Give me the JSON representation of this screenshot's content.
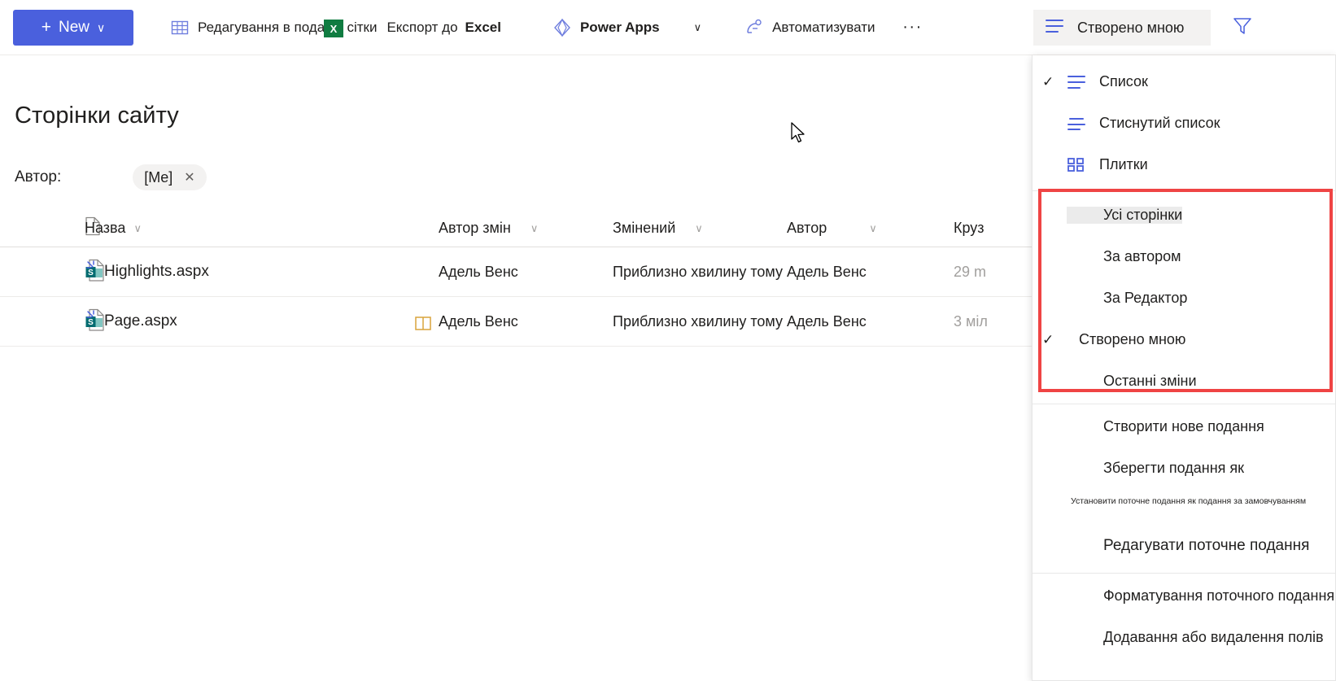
{
  "commandbar": {
    "new_button": {
      "label": "New",
      "plus": "+",
      "chevron": "∨"
    },
    "items": [
      {
        "name": "grid-edit",
        "label": "Редагування в поданні сітки",
        "icon": "grid-icon"
      },
      {
        "name": "export-excel",
        "label": "Експорт до",
        "label2": "Excel",
        "icon": "excel-icon"
      },
      {
        "name": "power-apps",
        "label": "Power Apps",
        "icon": "powerapps-icon",
        "chevron": "∨"
      },
      {
        "name": "automate",
        "label": "Автоматизувати",
        "icon": "automate-icon"
      }
    ],
    "overflow": "···"
  },
  "view": {
    "current_label": "Створено мною",
    "filter_icon": "filter-icon",
    "menu": [
      {
        "label": "Список",
        "icon": "list-icon",
        "checked": true,
        "group": "layout"
      },
      {
        "label": "Стиснутий список",
        "icon": "compact-list-icon",
        "checked": false,
        "group": "layout"
      },
      {
        "label": "Плитки",
        "icon": "tiles-icon",
        "checked": false,
        "group": "layout"
      },
      {
        "label": "Усі сторінки",
        "checked": false,
        "group": "views",
        "highlighted": true
      },
      {
        "label": "За автором",
        "checked": false,
        "group": "views"
      },
      {
        "label": "За Редактор",
        "checked": false,
        "group": "views"
      },
      {
        "label": "Створено мною",
        "checked": true,
        "group": "views"
      },
      {
        "label": "Останні зміни",
        "checked": false,
        "group": "views"
      },
      {
        "label": "Створити нове подання",
        "checked": false,
        "group": "actions"
      },
      {
        "label": "Зберегти подання як",
        "checked": false,
        "group": "actions"
      },
      {
        "label": "Редагувати поточне подання",
        "checked": false,
        "group": "actions"
      },
      {
        "label": "Форматування поточного подання",
        "checked": false,
        "group": "format"
      },
      {
        "label": "Додавання або видалення полів",
        "checked": false,
        "group": "format"
      }
    ],
    "hint": "Установити поточне подання як подання за замовчуванням"
  },
  "page": {
    "title": "Сторінки сайту",
    "filter_label": "Автор:",
    "filter_pill": {
      "value": "[Me]",
      "remove": "✕"
    }
  },
  "table": {
    "columns": [
      {
        "key": "type",
        "label": "",
        "icon": "document-icon"
      },
      {
        "key": "name",
        "label": "Назва",
        "chevron": "∨"
      },
      {
        "key": "editor",
        "label": "Автор змін",
        "chevron": "∨"
      },
      {
        "key": "modified",
        "label": "Змінений",
        "chevron": "∨"
      },
      {
        "key": "author",
        "label": "Автор",
        "chevron": "∨"
      },
      {
        "key": "last",
        "label": "Круз",
        "chevron": ""
      }
    ],
    "rows": [
      {
        "type_icon": "sharepoint-page-icon",
        "shared_icon": "share-burst-icon",
        "name": "Highlights.aspx",
        "badge": "",
        "editor": "Адель Венс",
        "modified": "Приблизно хвилину тому",
        "author": "Адель Венс",
        "last": "29 m"
      },
      {
        "type_icon": "sharepoint-page-icon",
        "shared_icon": "share-burst-icon",
        "name": "Page.aspx",
        "badge": "book-icon",
        "editor": "Адель Венс",
        "modified": "Приблизно хвилину тому",
        "author": "Адель Венс",
        "last": "3 міл"
      }
    ]
  },
  "colors": {
    "accent": "#4a60dd",
    "highlight_box": "#ef4444",
    "sharepoint_teal": "#036c70",
    "excel_green": "#107c41",
    "badge_orange": "#d9a43b"
  }
}
